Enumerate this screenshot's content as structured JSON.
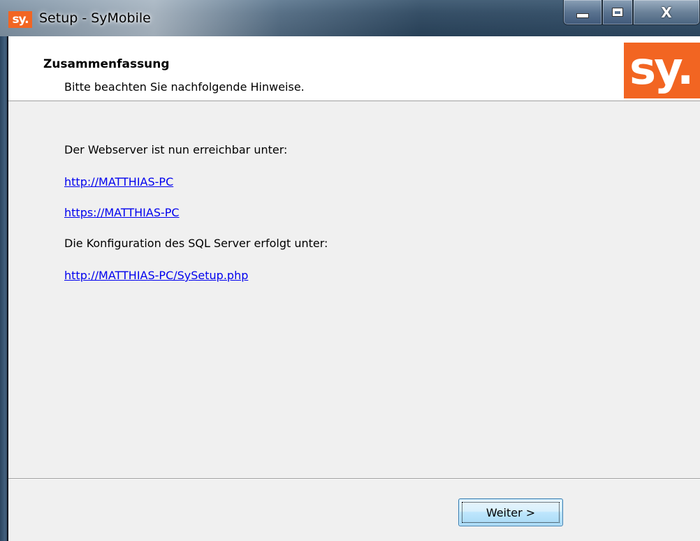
{
  "window": {
    "title": "Setup - SyMobile",
    "app_icon_text": "sy.",
    "caption_buttons": {
      "minimize_icon": "minimize-icon",
      "maximize_icon": "maximize-icon",
      "close_icon": "close-icon",
      "close_glyph": "X"
    }
  },
  "header": {
    "title": "Zusammenfassung",
    "subtitle": "Bitte beachten Sie nachfolgende Hinweise.",
    "logo_text": "sy."
  },
  "content": {
    "webserver_label": "Der Webserver ist nun erreichbar unter:",
    "http_link": "http://MATTHIAS-PC",
    "https_link": "https://MATTHIAS-PC",
    "sql_label": "Die Konfiguration des SQL Server erfolgt unter:",
    "setup_link": "http://MATTHIAS-PC/SySetup.php"
  },
  "footer": {
    "next_button_label": "Weiter >"
  },
  "colors": {
    "brand_orange": "#f26522",
    "link_blue": "#0000ee",
    "dialog_background": "#f0f0f0"
  }
}
